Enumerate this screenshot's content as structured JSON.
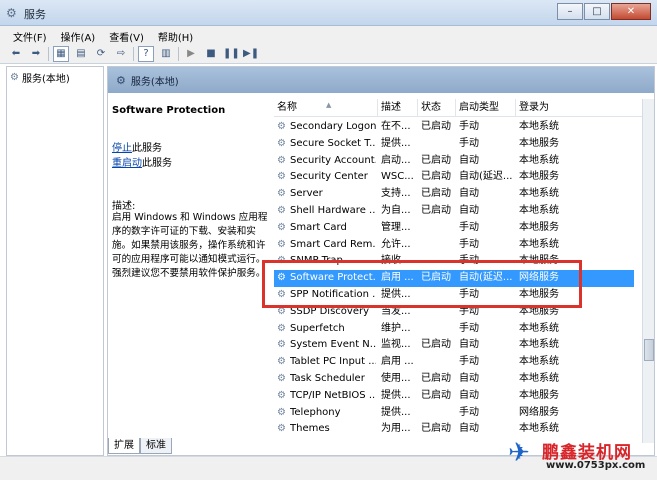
{
  "window": {
    "title": "服务"
  },
  "menu": [
    "文件(F)",
    "操作(A)",
    "查看(V)",
    "帮助(H)"
  ],
  "tree": {
    "root_label": "服务(本地)"
  },
  "content": {
    "header_title": "服务(本地)"
  },
  "details": {
    "service_name": "Software Protection",
    "stop_link": "停止",
    "stop_suffix": "此服务",
    "restart_link": "重启动",
    "restart_suffix": "此服务",
    "desc_label": "描述:",
    "description": "启用 Windows 和 Windows 应用程序的数字许可证的下载、安装和实施。如果禁用该服务，操作系统和许可的应用程序可能以通知模式运行。强烈建议您不要禁用软件保护服务。"
  },
  "columns": [
    "名称",
    "描述",
    "状态",
    "启动类型",
    "登录为"
  ],
  "rows": [
    {
      "name": "Secondary Logon",
      "desc": "在不...",
      "status": "已启动",
      "startup": "手动",
      "logon": "本地系统"
    },
    {
      "name": "Secure Socket T...",
      "desc": "提供...",
      "status": "",
      "startup": "手动",
      "logon": "本地服务"
    },
    {
      "name": "Security Account...",
      "desc": "启动...",
      "status": "已启动",
      "startup": "自动",
      "logon": "本地系统"
    },
    {
      "name": "Security Center",
      "desc": "WSC...",
      "status": "已启动",
      "startup": "自动(延迟...",
      "logon": "本地服务"
    },
    {
      "name": "Server",
      "desc": "支持...",
      "status": "已启动",
      "startup": "自动",
      "logon": "本地系统"
    },
    {
      "name": "Shell Hardware ...",
      "desc": "为自...",
      "status": "已启动",
      "startup": "自动",
      "logon": "本地系统"
    },
    {
      "name": "Smart Card",
      "desc": "管理...",
      "status": "",
      "startup": "手动",
      "logon": "本地服务"
    },
    {
      "name": "Smart Card Rem...",
      "desc": "允许...",
      "status": "",
      "startup": "手动",
      "logon": "本地系统"
    },
    {
      "name": "SNMP Trap",
      "desc": "接收...",
      "status": "",
      "startup": "手动",
      "logon": "本地服务"
    },
    {
      "name": "Software Protect...",
      "desc": "启用 ...",
      "status": "已启动",
      "startup": "自动(延迟...",
      "logon": "网络服务"
    },
    {
      "name": "SPP Notification ...",
      "desc": "提供...",
      "status": "",
      "startup": "手动",
      "logon": "本地服务"
    },
    {
      "name": "SSDP Discovery",
      "desc": "当发...",
      "status": "",
      "startup": "手动",
      "logon": "本地服务"
    },
    {
      "name": "Superfetch",
      "desc": "维护...",
      "status": "",
      "startup": "手动",
      "logon": "本地系统"
    },
    {
      "name": "System Event N...",
      "desc": "监视...",
      "status": "已启动",
      "startup": "自动",
      "logon": "本地系统"
    },
    {
      "name": "Tablet PC Input ...",
      "desc": "启用 ...",
      "status": "",
      "startup": "手动",
      "logon": "本地系统"
    },
    {
      "name": "Task Scheduler",
      "desc": "使用...",
      "status": "已启动",
      "startup": "自动",
      "logon": "本地系统"
    },
    {
      "name": "TCP/IP NetBIOS ...",
      "desc": "提供...",
      "status": "已启动",
      "startup": "自动",
      "logon": "本地服务"
    },
    {
      "name": "Telephony",
      "desc": "提供...",
      "status": "",
      "startup": "手动",
      "logon": "网络服务"
    },
    {
      "name": "Themes",
      "desc": "为用...",
      "status": "已启动",
      "startup": "自动",
      "logon": "本地系统"
    }
  ],
  "selected_row_index": 9,
  "tabs": [
    "扩展",
    "标准"
  ],
  "watermark": {
    "brand": "鹏鑫装机网",
    "url": "www.0753px.com"
  },
  "colors": {
    "selection": "#3399ff",
    "highlight_box": "#d9332b",
    "link": "#0645ad"
  }
}
